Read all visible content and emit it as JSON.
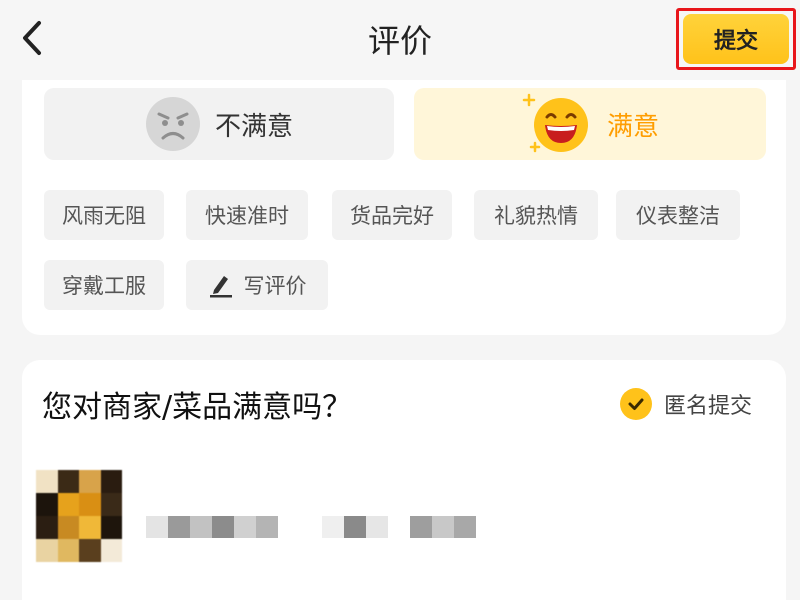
{
  "header": {
    "title": "评价",
    "submit_label": "提交"
  },
  "rating": {
    "unsatisfied_label": "不满意",
    "satisfied_label": "满意",
    "selected": "满意",
    "accent": "#ff9d00"
  },
  "tags": [
    "风雨无阻",
    "快速准时",
    "货品完好",
    "礼貌热情",
    "仪表整洁",
    "穿戴工服"
  ],
  "write_review_label": "写评价",
  "merchant": {
    "question": "您对商家/菜品满意吗？",
    "anonymous_label": "匿名提交",
    "anonymous_checked": true
  },
  "icons": {
    "back": "chevron-left-icon",
    "unsatisfied": "frown-face-icon",
    "satisfied": "laughing-face-icon",
    "write": "pen-icon",
    "check": "check-icon"
  },
  "colors": {
    "submit": "#ffc21a",
    "highlight_border": "#e8161b",
    "satisfied_bg": "#fff6d9"
  }
}
